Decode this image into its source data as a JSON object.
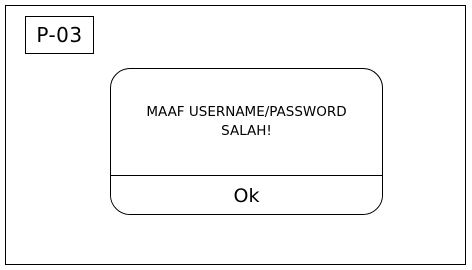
{
  "screen": {
    "id_label": "P-03"
  },
  "dialog": {
    "message": "MAAF USERNAME/PASSWORD SALAH!",
    "ok_label": "Ok"
  }
}
